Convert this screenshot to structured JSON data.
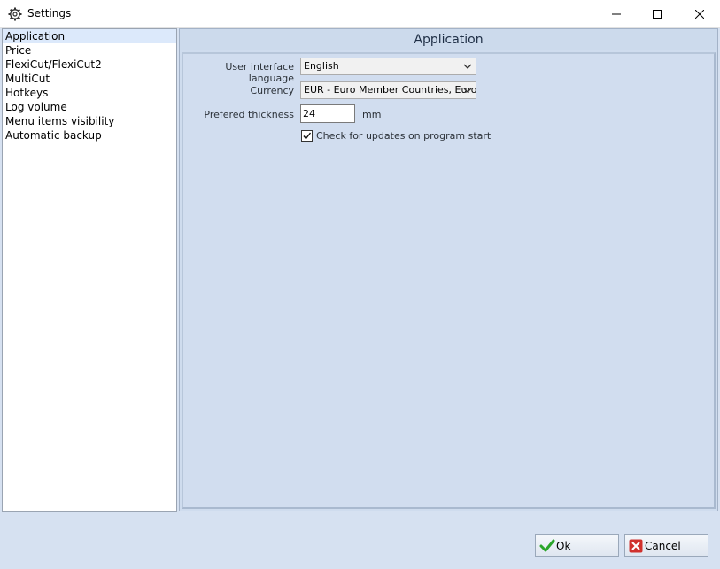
{
  "window": {
    "title": "Settings"
  },
  "nav": {
    "items": [
      {
        "label": "Application",
        "selected": true
      },
      {
        "label": "Price",
        "selected": false
      },
      {
        "label": "FlexiCut/FlexiCut2",
        "selected": false
      },
      {
        "label": "MultiCut",
        "selected": false
      },
      {
        "label": "Hotkeys",
        "selected": false
      },
      {
        "label": "Log volume",
        "selected": false
      },
      {
        "label": "Menu items visibility",
        "selected": false
      },
      {
        "label": "Automatic backup",
        "selected": false
      }
    ]
  },
  "panel": {
    "title": "Application",
    "language": {
      "label": "User interface language",
      "value": "English"
    },
    "currency": {
      "label": "Currency",
      "value": "EUR - Euro Member Countries, Euro"
    },
    "thickness": {
      "label": "Prefered thickness",
      "value": "24",
      "unit": "mm"
    },
    "updates": {
      "label": "Check for updates on program start",
      "checked": true
    }
  },
  "buttons": {
    "ok": "Ok",
    "cancel": "Cancel"
  },
  "icons": {
    "app": "gear-icon",
    "minimize": "minimize-icon",
    "maximize": "maximize-icon",
    "close": "close-icon",
    "ok": "checkmark-icon",
    "cancel": "cross-icon"
  },
  "colors": {
    "ok_icon": "#2aa52a",
    "cancel_icon": "#d0312d",
    "selection": "#dce9fb"
  }
}
